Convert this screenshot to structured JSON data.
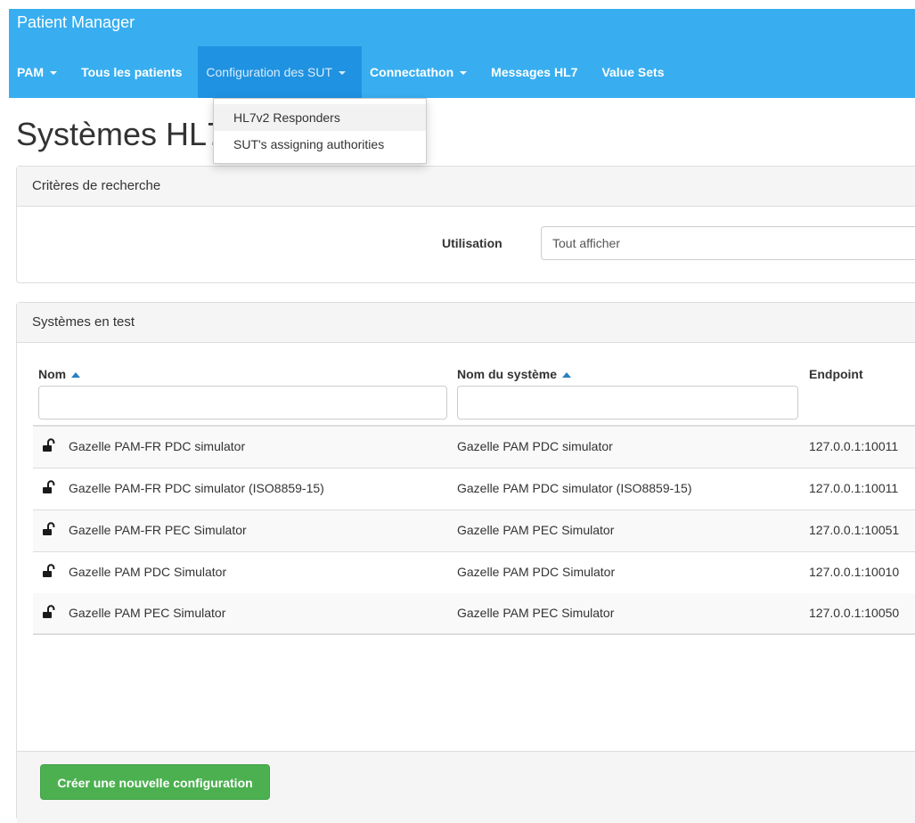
{
  "app": {
    "title": "Patient Manager"
  },
  "nav": {
    "items": [
      {
        "label": "PAM",
        "dropdown": true,
        "active": false
      },
      {
        "label": "Tous les patients",
        "dropdown": false,
        "active": false
      },
      {
        "label": "Configuration des SUT",
        "dropdown": true,
        "active": true
      },
      {
        "label": "Connectathon",
        "dropdown": true,
        "active": false
      },
      {
        "label": "Messages HL7",
        "dropdown": false,
        "active": false
      },
      {
        "label": "Value Sets",
        "dropdown": false,
        "active": false
      }
    ]
  },
  "dropdown_menu": {
    "items": [
      {
        "label": "HL7v2 Responders",
        "highlighted": true
      },
      {
        "label": "SUT's assigning authorities",
        "highlighted": false
      }
    ]
  },
  "page": {
    "title": "Systèmes HL7"
  },
  "search_panel": {
    "title": "Critères de recherche",
    "filter_label": "Utilisation",
    "filter_value": "Tout afficher"
  },
  "sut_panel": {
    "title": "Systèmes en test",
    "columns": [
      "Nom",
      "Nom du système",
      "Endpoint"
    ],
    "rows": [
      {
        "name": "Gazelle PAM-FR PDC simulator",
        "system": "Gazelle PAM PDC simulator",
        "endpoint": "127.0.0.1:10011"
      },
      {
        "name": "Gazelle PAM-FR PDC simulator (ISO8859-15)",
        "system": "Gazelle PAM PDC simulator (ISO8859-15)",
        "endpoint": "127.0.0.1:10011"
      },
      {
        "name": "Gazelle PAM-FR PEC Simulator",
        "system": "Gazelle PAM PEC Simulator",
        "endpoint": "127.0.0.1:10051"
      },
      {
        "name": "Gazelle PAM PDC Simulator",
        "system": "Gazelle PAM PDC Simulator",
        "endpoint": "127.0.0.1:10010"
      },
      {
        "name": "Gazelle PAM PEC Simulator",
        "system": "Gazelle PAM PEC Simulator",
        "endpoint": "127.0.0.1:10050"
      }
    ],
    "create_button": "Créer une nouvelle configuration"
  },
  "colors": {
    "navbar": "#38aef0",
    "nav_active": "#1f92e1",
    "button_green": "#4cb050",
    "sort_arrow": "#2a7fc0"
  }
}
